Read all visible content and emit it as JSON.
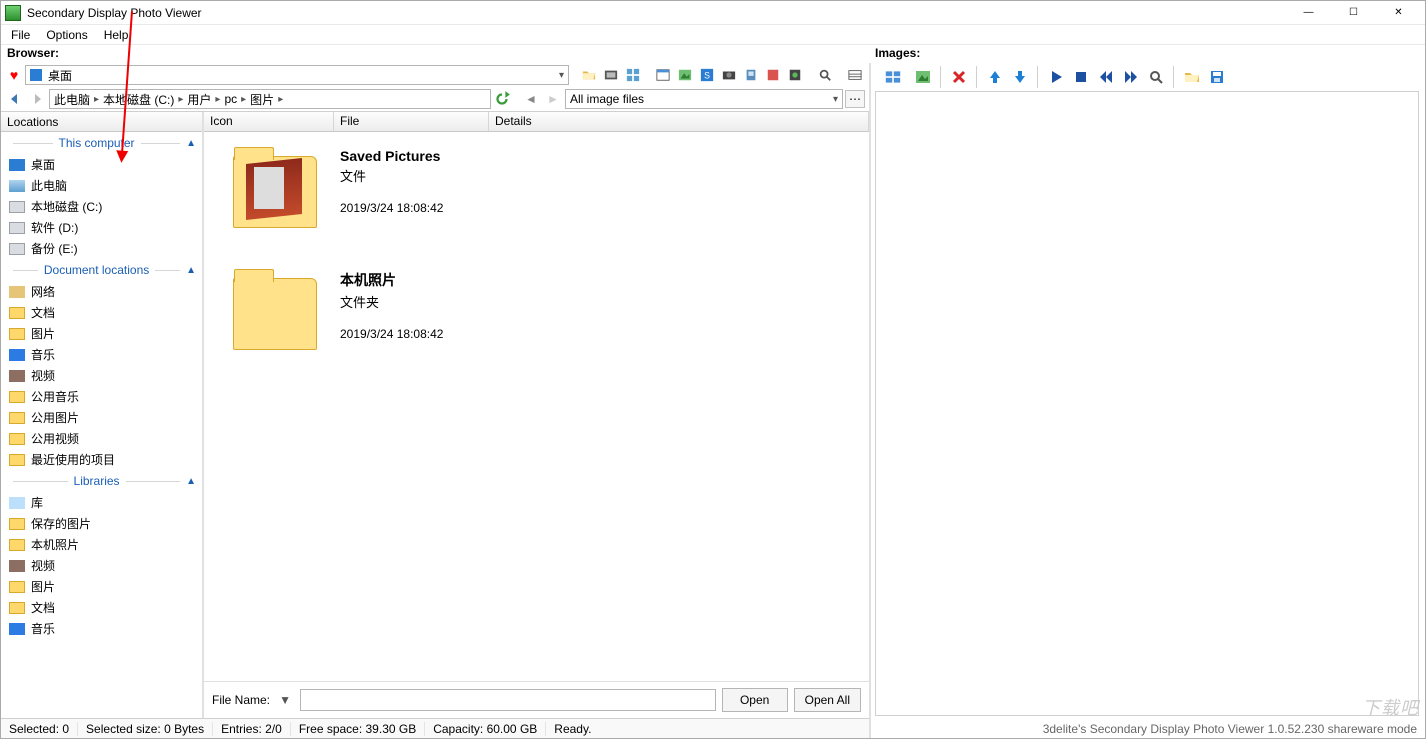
{
  "titlebar": {
    "title": "Secondary Display Photo Viewer"
  },
  "menubar": [
    "File",
    "Options",
    "Help"
  ],
  "section_labels": {
    "browser": "Browser:",
    "images": "Images:"
  },
  "browser": {
    "location_text": "桌面",
    "breadcrumbs": [
      "此电脑",
      "本地磁盘 (C:)",
      "用户",
      "pc",
      "图片"
    ],
    "filter_label": "All image files",
    "toolbar_icons": [
      "open-folder",
      "film",
      "thumbnails",
      "window",
      "photo",
      "s-badge",
      "camera",
      "device",
      "red-square",
      "green-dot",
      "search",
      "grid"
    ]
  },
  "sidebar": {
    "locations_header": "Locations",
    "groups": [
      {
        "title": "This computer",
        "items": [
          {
            "icon": "desktop",
            "label": "桌面"
          },
          {
            "icon": "pc",
            "label": "此电脑"
          },
          {
            "icon": "disk",
            "label": "本地磁盘 (C:)"
          },
          {
            "icon": "disk",
            "label": "软件 (D:)"
          },
          {
            "icon": "disk",
            "label": "备份 (E:)"
          }
        ]
      },
      {
        "title": "Document locations",
        "items": [
          {
            "icon": "net",
            "label": "网络"
          },
          {
            "icon": "folder",
            "label": "文档"
          },
          {
            "icon": "folder",
            "label": "图片"
          },
          {
            "icon": "music",
            "label": "音乐"
          },
          {
            "icon": "video",
            "label": "视频"
          },
          {
            "icon": "folder",
            "label": "公用音乐"
          },
          {
            "icon": "folder",
            "label": "公用图片"
          },
          {
            "icon": "folder",
            "label": "公用视频"
          },
          {
            "icon": "folder",
            "label": "最近使用的项目"
          }
        ]
      },
      {
        "title": "Libraries",
        "items": [
          {
            "icon": "libs",
            "label": "库"
          },
          {
            "icon": "folder",
            "label": "保存的图片"
          },
          {
            "icon": "folder",
            "label": "本机照片"
          },
          {
            "icon": "video",
            "label": "视频"
          },
          {
            "icon": "folder",
            "label": "图片"
          },
          {
            "icon": "folder",
            "label": "文档"
          },
          {
            "icon": "music",
            "label": "音乐"
          }
        ]
      }
    ]
  },
  "file_area": {
    "headers": {
      "icon": "Icon",
      "file": "File",
      "details": "Details"
    },
    "rows": [
      {
        "name": "Saved Pictures",
        "type": "文件",
        "date": "2019/3/24 18:08:42",
        "thumb": "filled"
      },
      {
        "name": "本机照片",
        "type": "文件夹",
        "date": "2019/3/24 18:08:42",
        "thumb": "empty"
      }
    ],
    "footer": {
      "label": "File Name:",
      "open": "Open",
      "open_all": "Open All"
    }
  },
  "images_panel": {
    "toolbar_icons": [
      "grid-view",
      "image-view",
      "delete",
      "arrow-up",
      "arrow-down",
      "play",
      "stop",
      "rewind",
      "forward",
      "zoom",
      "open",
      "save"
    ]
  },
  "statusbar": {
    "selected": "Selected: 0",
    "selected_size": "Selected size: 0 Bytes",
    "entries": "Entries: 2/0",
    "free": "Free space: 39.30 GB",
    "capacity": "Capacity: 60.00 GB",
    "ready": "Ready."
  },
  "footer_credit": "3delite's Secondary Display Photo Viewer 1.0.52.230 shareware mode",
  "watermark": "下载吧"
}
